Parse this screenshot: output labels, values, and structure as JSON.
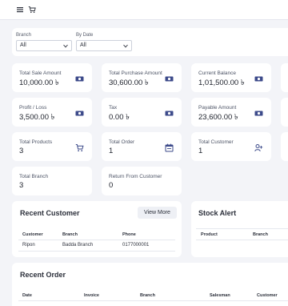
{
  "topbar": {
    "menu_icon": "hamburger-menu-icon",
    "cart_icon": "shopping-cart-icon"
  },
  "filters": {
    "branch": {
      "label": "Branch",
      "value": "All"
    },
    "by_date": {
      "label": "By Date",
      "value": "All"
    }
  },
  "currency_symbol": "৳",
  "stats": {
    "total_sale_amount": {
      "label": "Total Sale Amount",
      "value": "10,000.00 ৳",
      "icon": "cash-icon"
    },
    "total_purchase_amount": {
      "label": "Total Purchase Amount",
      "value": "30,600.00 ৳",
      "icon": "cash-icon"
    },
    "current_balance": {
      "label": "Current Balance",
      "value": "1,01,500.00 ৳",
      "icon": "cash-icon"
    },
    "profit_loss": {
      "label": "Profit / Loss",
      "value": "3,500.00 ৳",
      "icon": "cash-icon"
    },
    "tax": {
      "label": "Tax",
      "value": "0.00 ৳",
      "icon": "cash-icon"
    },
    "payable_amount": {
      "label": "Payable Amount",
      "value": "23,600.00 ৳",
      "icon": "cash-icon"
    },
    "total_products": {
      "label": "Total Products",
      "value": "3",
      "icon": "cart-icon"
    },
    "total_order": {
      "label": "Total Order",
      "value": "1",
      "icon": "calendar-icon"
    },
    "total_customer": {
      "label": "Total Customer",
      "value": "1",
      "icon": "user-plus-icon"
    },
    "total_branch": {
      "label": "Total Branch",
      "value": "3"
    },
    "return_from_customer": {
      "label": "Return From Customer",
      "value": "0"
    }
  },
  "recent_customer": {
    "title": "Recent Customer",
    "view_more": "View More",
    "columns": [
      "Customer",
      "Branch",
      "Phone"
    ],
    "rows": [
      {
        "customer": "Ripon",
        "branch": "Badda Branch",
        "phone": "0177000001"
      }
    ]
  },
  "stock_alert": {
    "title": "Stock Alert",
    "columns": [
      "Product",
      "Branch"
    ]
  },
  "recent_order": {
    "title": "Recent Order",
    "columns": [
      "Date",
      "Invoice",
      "Branch",
      "Salesman",
      "Customer"
    ]
  },
  "colors": {
    "background": "#f3f4f8",
    "card": "#ffffff",
    "text": "#2b2f3a",
    "icon_blue": "#3c4a8a"
  }
}
